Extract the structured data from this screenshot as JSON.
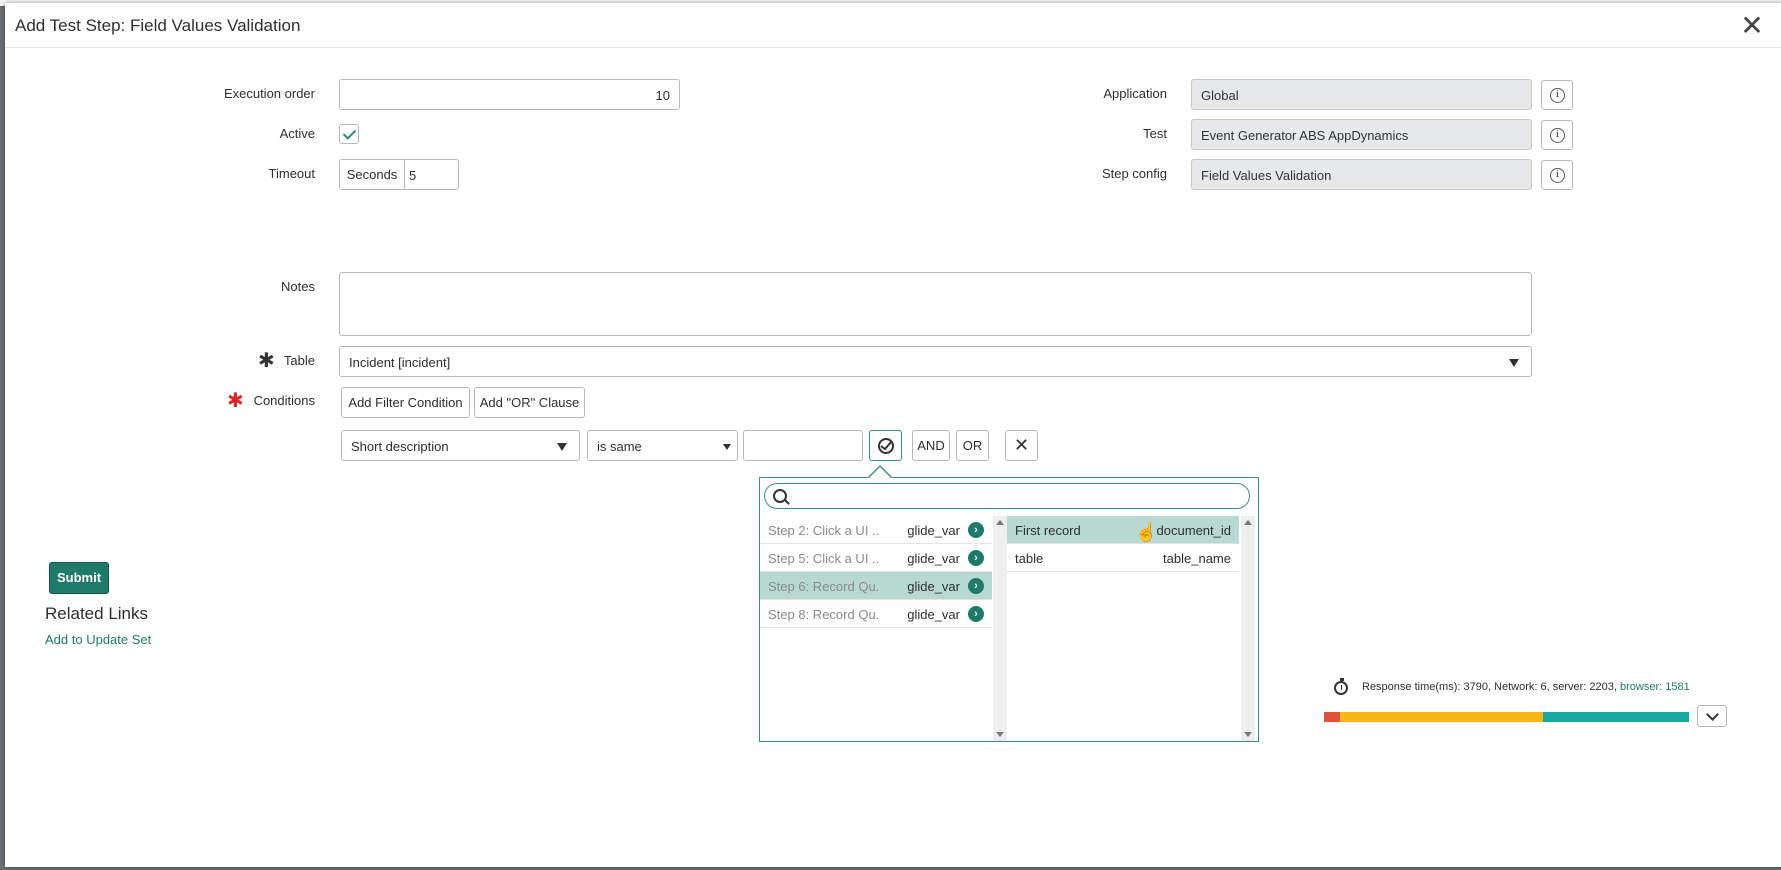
{
  "modal": {
    "title": "Add Test Step: Field Values Validation",
    "close_symbol": "✕"
  },
  "form": {
    "execution_order": {
      "label": "Execution order",
      "value": "10"
    },
    "active": {
      "label": "Active",
      "checked": true
    },
    "timeout": {
      "label": "Timeout",
      "unit": "Seconds",
      "value": "5"
    },
    "application": {
      "label": "Application",
      "value": "Global"
    },
    "test": {
      "label": "Test",
      "value": "Event Generator ABS AppDynamics"
    },
    "step_config": {
      "label": "Step config",
      "value": "Field Values Validation"
    },
    "notes": {
      "label": "Notes",
      "value": ""
    },
    "table": {
      "label": "Table",
      "value": "Incident [incident]"
    },
    "conditions": {
      "label": "Conditions",
      "add_filter_label": "Add Filter Condition",
      "add_or_label": "Add \"OR\" Clause",
      "field": "Short description",
      "operator": "is same",
      "value": "",
      "and_label": "AND",
      "or_label": "OR"
    }
  },
  "picker": {
    "search_placeholder": "",
    "left_items": [
      {
        "name": "Step 2: Click a UI ...",
        "type": "glide_var"
      },
      {
        "name": "Step 5: Click a UI ...",
        "type": "glide_var"
      },
      {
        "name": "Step 6: Record Qu...",
        "type": "glide_var"
      },
      {
        "name": "Step 8: Record Qu...",
        "type": "glide_var"
      }
    ],
    "right_items": [
      {
        "name": "First record",
        "type": "document_id"
      },
      {
        "name": "table",
        "type": "table_name"
      }
    ]
  },
  "actions": {
    "submit_label": "Submit"
  },
  "related_links": {
    "title": "Related Links",
    "add_to_update_set": "Add to Update Set"
  },
  "response_time": {
    "prefix": "Response time(ms): 3790, Network: 6, server: 2203, ",
    "browser": "browser: 1581",
    "network_ms": 6,
    "server_ms": 2203,
    "browser_ms": 1581,
    "colors": {
      "network": "#e0523a",
      "server": "#f7b718",
      "browser": "#18a8a0"
    }
  },
  "colors": {
    "accent": "#1f7a6a",
    "selected_row": "#b7d9d1",
    "required": "#d9252a"
  }
}
